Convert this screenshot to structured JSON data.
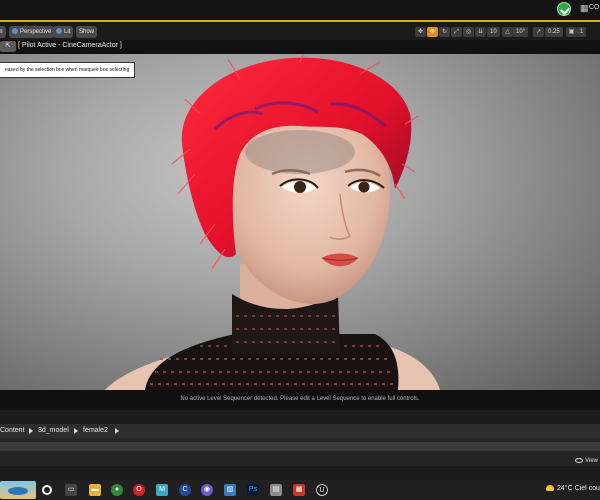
{
  "topbar": {
    "grid_glyph": "▦",
    "app_text": "CO"
  },
  "viewport_toolbar": {
    "left_button": {
      "glyph": "≡"
    },
    "perspective_label": "Perspective",
    "lit_label": "Lit",
    "show_label": "Show",
    "grid_snap_value": "10",
    "rotate_snap_value": "10°",
    "scale_snap_value": "0.25",
    "camera_speed_value": "1"
  },
  "pilot": {
    "button_glyph": "⇱",
    "text": "[ Pilot Active - CineCameraActor ]"
  },
  "tooltip": {
    "text": "eased by the selection box when marquee box selecting"
  },
  "status": {
    "message": "No active Level Sequencer detected. Please edit a Level Sequence to enable full controls."
  },
  "content_browser": {
    "breadcrumb": [
      "Content",
      "3d_model",
      "female2"
    ],
    "view_options_label": "View"
  },
  "taskbar": {
    "weather_temp": "24°C",
    "weather_text": "Ciel cou"
  },
  "colors": {
    "accent": "#e0b000",
    "active_tool": "#e58a1f",
    "hair": "#e8102a",
    "hair_shadow": "#5a1a8a"
  }
}
